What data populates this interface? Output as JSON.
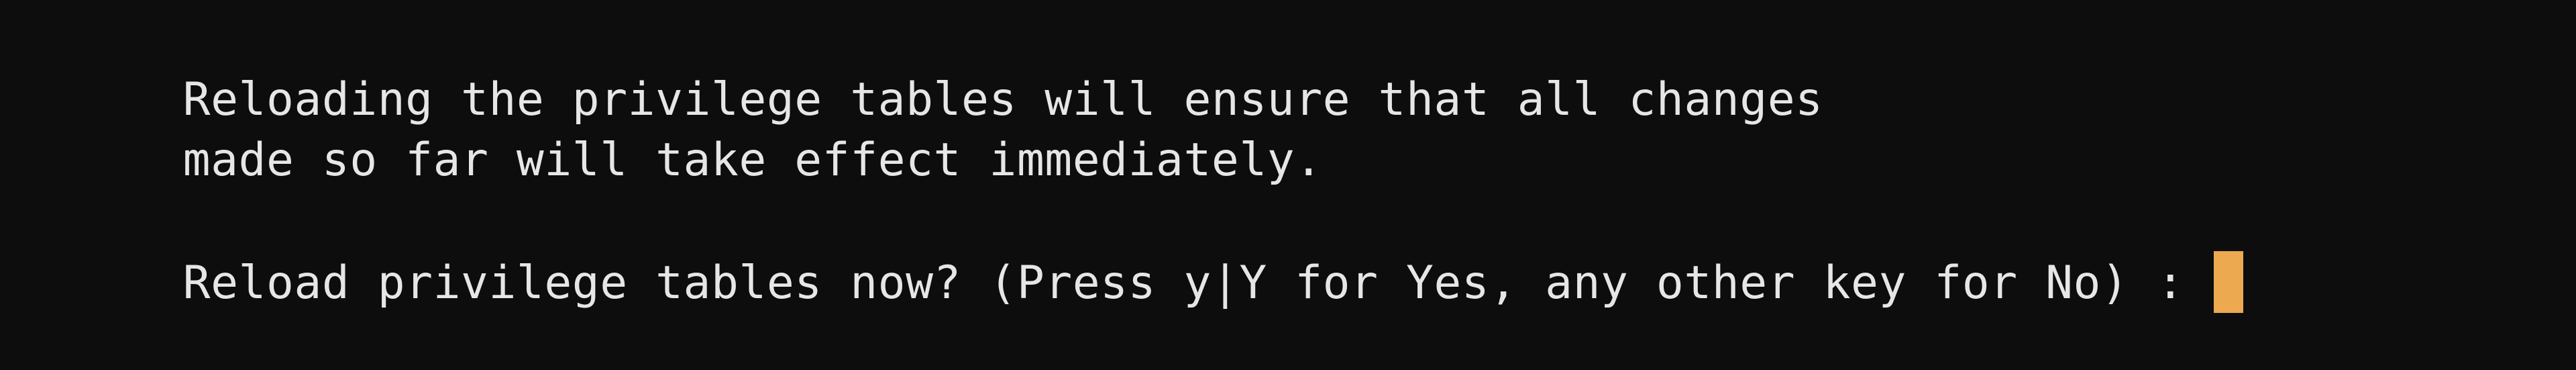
{
  "terminal": {
    "background_color": "#0d0d0d",
    "foreground_color": "#e6e6e6",
    "cursor_color": "#eda94f",
    "lines": [
      {
        "id": "info-line-1",
        "text": "Reloading the privilege tables will ensure that all changes"
      },
      {
        "id": "info-line-2",
        "text": "made so far will take effect immediately."
      },
      {
        "id": "blank-line",
        "text": ""
      },
      {
        "id": "prompt-line",
        "text": "Reload privilege tables now? (Press y|Y for Yes, any other key for No) : "
      }
    ],
    "prompt": {
      "question": "Reload privilege tables now?",
      "hint": "(Press y|Y for Yes, any other key for No)",
      "separator": " : ",
      "input_value": "",
      "cursor_glyph": "block-cursor"
    }
  }
}
